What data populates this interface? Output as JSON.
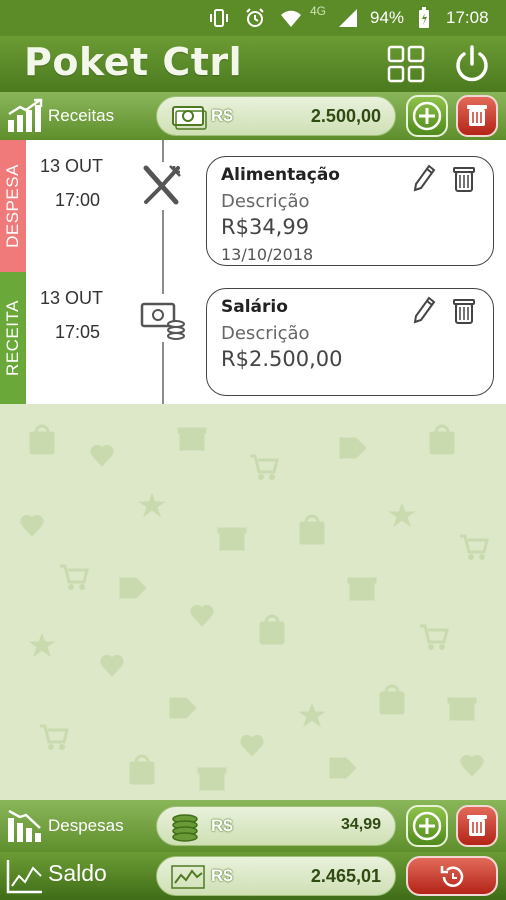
{
  "status_bar": {
    "network": "4G",
    "battery": "94%",
    "time": "17:08"
  },
  "header": {
    "title": "Poket Ctrl"
  },
  "receitas": {
    "label": "Receitas",
    "currency": "R$",
    "amount": "2.500,00"
  },
  "entries": [
    {
      "type_label": "DESPESA",
      "type_color": "#f07a7a",
      "date": "13 OUT",
      "time": "17:00",
      "icon": "fork-knife-icon",
      "title": "Alimentação",
      "description": "Descrição",
      "value": "R$34,99",
      "entry_date": "13/10/2018"
    },
    {
      "type_label": "RECEITA",
      "type_color": "#6aa83a",
      "date": "13 OUT",
      "time": "17:05",
      "icon": "money-coins-icon",
      "title": "Salário",
      "description": "Descrição",
      "value": "R$2.500,00"
    }
  ],
  "despesas": {
    "label": "Despesas",
    "currency": "R$",
    "amount": "34,99"
  },
  "saldo": {
    "label": "Saldo",
    "currency": "R$",
    "amount": "2.465,01"
  },
  "colors": {
    "primary_green": "#5c8c28",
    "add_green": "#6aa83a",
    "delete_red": "#c8392b",
    "despesa_tag": "#f07a7a",
    "receita_tag": "#6aa83a"
  }
}
